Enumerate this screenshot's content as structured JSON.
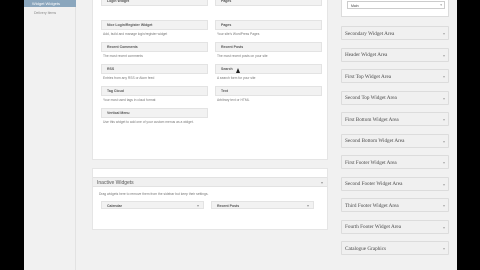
{
  "admin_menu": {
    "current": "Widget Widgets",
    "sub": "Delivery Items"
  },
  "available_widgets": [
    {
      "title": "Login Widget",
      "desc": "",
      "col": 0,
      "row": 0
    },
    {
      "title": "Pages",
      "desc": "",
      "col": 1,
      "row": 0
    },
    {
      "title": "Nice Login/Register Widget",
      "desc": "Add, build and manage login/register widget",
      "col": 0,
      "row": 1
    },
    {
      "title": "Pages",
      "desc": "Your site's WordPress Pages",
      "col": 1,
      "row": 1
    },
    {
      "title": "Recent Comments",
      "desc": "The most recent comments",
      "col": 0,
      "row": 2
    },
    {
      "title": "Recent Posts",
      "desc": "The most recent posts on your site",
      "col": 1,
      "row": 2
    },
    {
      "title": "RSS",
      "desc": "Entries from any RSS or Atom feed",
      "col": 0,
      "row": 3
    },
    {
      "title": "Search",
      "desc": "A search form for your site",
      "col": 1,
      "row": 3
    },
    {
      "title": "Tag Cloud",
      "desc": "Your most used tags in cloud format",
      "col": 0,
      "row": 4
    },
    {
      "title": "Text",
      "desc": "Arbitrary text or HTML",
      "col": 1,
      "row": 4
    },
    {
      "title": "Vertical Menu",
      "desc": "Use this widget to add one of your custom menus as a widget.",
      "col": 0,
      "row": 5
    }
  ],
  "inactive": {
    "title": "Inactive Widgets",
    "desc": "Drag widgets here to remove them from the sidebar but keep their settings.",
    "widgets": [
      "Calendar",
      "Recent Posts"
    ]
  },
  "menu_select": {
    "value": "Main"
  },
  "sidebar_areas": [
    "Secondary Widget Area",
    "Header Widget Area",
    "First Top Widget Area",
    "Second Top Widget Area",
    "First Bottom Widget Area",
    "Second Bottom Widget Area",
    "First Footer Widget Area",
    "Second Footer Widget Area",
    "Third Footer Widget Area",
    "Fourth Footer Widget Area",
    "Catalogue Graphics"
  ],
  "icons": {
    "arrow": "triangle-down-icon",
    "cursor": "mouse-pointer-icon"
  }
}
